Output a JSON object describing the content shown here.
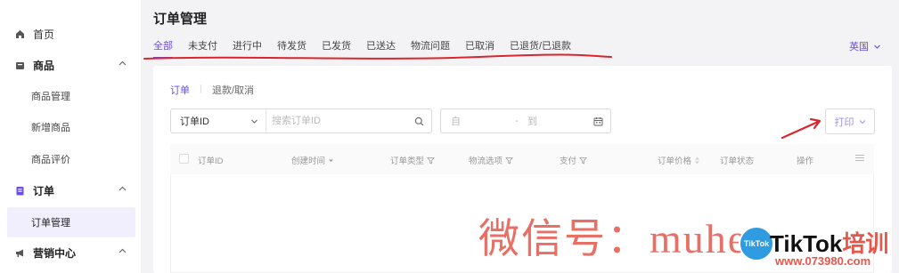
{
  "sidebar": {
    "items": [
      {
        "label": "首页",
        "icon": "home-icon"
      },
      {
        "label": "商品",
        "icon": "product-icon"
      },
      {
        "label": "商品管理"
      },
      {
        "label": "新增商品"
      },
      {
        "label": "商品评价"
      },
      {
        "label": "订单",
        "icon": "order-icon"
      },
      {
        "label": "订单管理"
      },
      {
        "label": "营销中心",
        "icon": "megaphone-icon"
      }
    ]
  },
  "header": {
    "title": "订单管理",
    "language": "英国"
  },
  "status_tabs": [
    "全部",
    "未支付",
    "进行中",
    "待发货",
    "已发货",
    "已送达",
    "物流问题",
    "已取消",
    "已退货/已退款"
  ],
  "sub_tabs": [
    "订单",
    "退款/取消"
  ],
  "filters": {
    "search_type": "订单ID",
    "search_placeholder": "搜索订单ID",
    "date_from": "自",
    "date_sep": "-",
    "date_to": "到"
  },
  "print_button": "打印",
  "table": {
    "columns": [
      "订单ID",
      "创建时间",
      "订单类型",
      "物流选项",
      "支付",
      "订单价格",
      "订单状态",
      "操作"
    ]
  },
  "watermark": {
    "text": "微信号：muhe",
    "logo": "TikTok",
    "brand": "TikTok",
    "brand_cn": "培训",
    "url": "www.073980.com"
  },
  "colors": {
    "accent": "#6b4ce6",
    "annotation": "#d9262c"
  }
}
